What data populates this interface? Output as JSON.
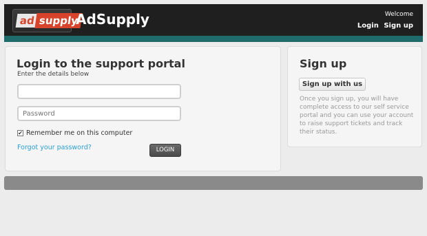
{
  "header": {
    "logo": {
      "ad": "ad",
      "supply": "supply"
    },
    "brand": "AdSupply",
    "welcome": "Welcome",
    "links": {
      "login": "Login",
      "signup": "Sign up"
    }
  },
  "login": {
    "title": "Login to the support portal",
    "subtitle": "Enter the details below",
    "username": {
      "value": "",
      "placeholder": ""
    },
    "password": {
      "value": "",
      "placeholder": "Password"
    },
    "remember_label": "Remember me on this computer",
    "remember_checked": true,
    "forgot_link": "Forgot your password?",
    "submit_label": "LOGIN"
  },
  "signup": {
    "title": "Sign up",
    "button_label": "Sign up with us",
    "description": "Once you sign up, you will have complete access to our self service portal and you can use your account to raise support tickets and track their status."
  },
  "colors": {
    "header_bg": "#1f1f1f",
    "header_stripe": "#1f6b6b",
    "brand_red": "#d7432b",
    "link_blue": "#2a9fd6"
  }
}
